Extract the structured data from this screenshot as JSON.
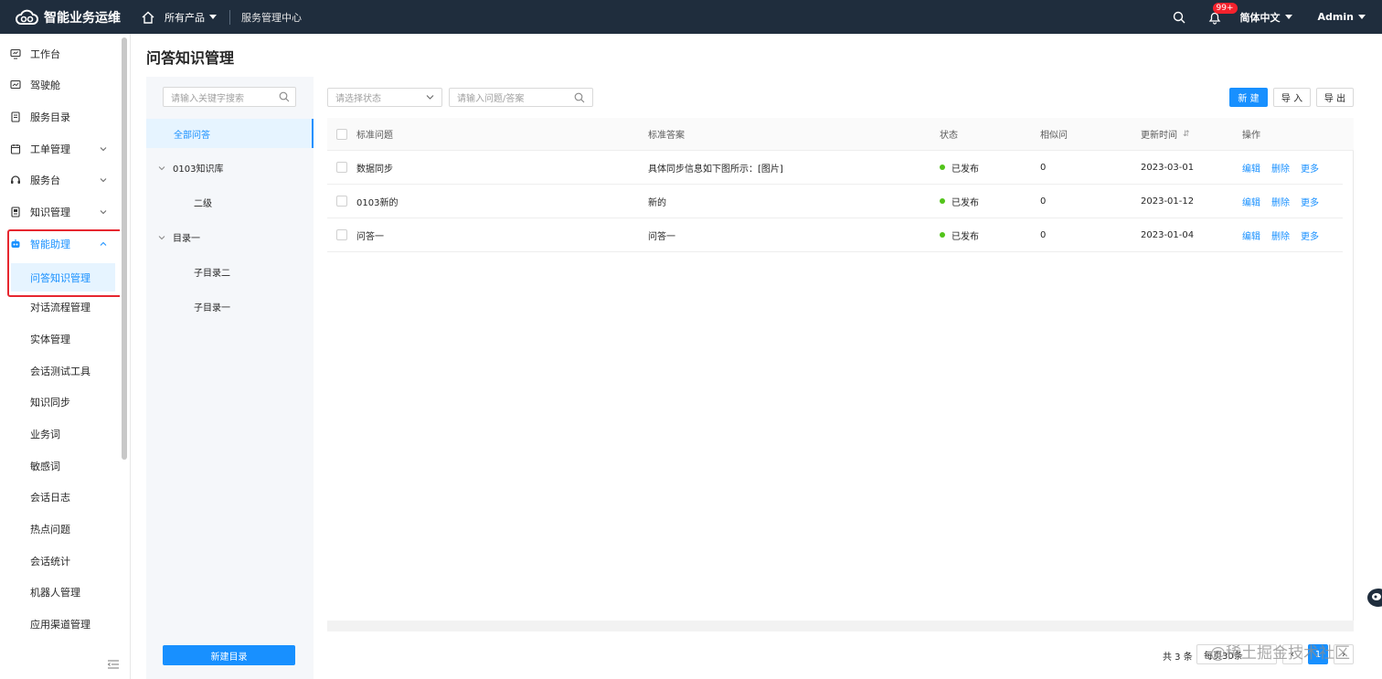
{
  "topbar": {
    "brand": "智能业务运维",
    "products_label": "所有产品",
    "center_name": "服务管理中心",
    "notification_badge": "99+",
    "language": "简体中文",
    "user": "Admin"
  },
  "sidebar": {
    "items": [
      {
        "label": "工作台",
        "icon": "monitor-icon"
      },
      {
        "label": "驾驶舱",
        "icon": "dashboard-icon"
      },
      {
        "label": "服务目录",
        "icon": "catalog-icon"
      },
      {
        "label": "工单管理",
        "icon": "ticket-icon"
      },
      {
        "label": "服务台",
        "icon": "headset-icon"
      },
      {
        "label": "知识管理",
        "icon": "knowledge-icon"
      },
      {
        "label": "智能助理",
        "icon": "robot-icon"
      }
    ],
    "sub_items": [
      {
        "label": "问答知识管理"
      },
      {
        "label": "对话流程管理"
      },
      {
        "label": "实体管理"
      },
      {
        "label": "会话测试工具"
      },
      {
        "label": "知识同步"
      },
      {
        "label": "业务词"
      },
      {
        "label": "敏感词"
      },
      {
        "label": "会话日志"
      },
      {
        "label": "热点问题"
      },
      {
        "label": "会话统计"
      },
      {
        "label": "机器人管理"
      },
      {
        "label": "应用渠道管理"
      }
    ]
  },
  "page": {
    "title": "问答知识管理"
  },
  "tree": {
    "search_placeholder": "请输入关键字搜索",
    "nodes": [
      "全部问答",
      "0103知识库",
      "二级",
      "目录一",
      "子目录二",
      "子目录一"
    ],
    "new_dir_button": "新建目录"
  },
  "filters": {
    "status_placeholder": "请选择状态",
    "query_placeholder": "请输入问题/答案",
    "btn_new": "新 建",
    "btn_import": "导 入",
    "btn_export": "导 出"
  },
  "table": {
    "columns": [
      "标准问题",
      "标准答案",
      "状态",
      "相似问",
      "更新时间",
      "操作"
    ],
    "rows": [
      {
        "question": "数据同步",
        "answer": "具体同步信息如下图所示：[图片]",
        "status": "已发布",
        "similar": "0",
        "updated": "2023-03-01"
      },
      {
        "question": "0103新的",
        "answer": "新的",
        "status": "已发布",
        "similar": "0",
        "updated": "2023-01-12"
      },
      {
        "question": "问答一",
        "answer": "问答一",
        "status": "已发布",
        "similar": "0",
        "updated": "2023-01-04"
      }
    ],
    "actions": {
      "edit": "编辑",
      "delete": "删除",
      "more": "更多"
    }
  },
  "pagination": {
    "total": "共 3 条",
    "page_size": "每页30条",
    "current_page": "1"
  },
  "watermark": "@稀土掘金技术社区",
  "colors": {
    "topbar_bg": "#1f2d3d",
    "primary": "#1890ff",
    "status_published": "#52c41a",
    "highlight_border": "#e6262f"
  }
}
